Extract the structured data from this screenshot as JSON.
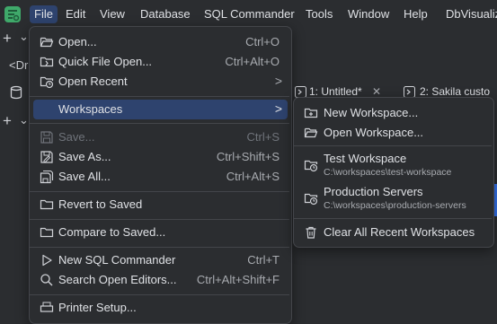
{
  "menubar": {
    "items": [
      "File",
      "Edit",
      "View",
      "Database",
      "SQL Commander",
      "Tools",
      "Window",
      "Help",
      "DbVisualiz"
    ]
  },
  "left_toolbar": {
    "plus": "+",
    "chevron": "⌄",
    "prefix": "<Dr"
  },
  "editor_tabs": [
    {
      "label": "1: Untitled*",
      "close": "✕"
    },
    {
      "label": "2: Sakila custo"
    }
  ],
  "file_menu": {
    "open": {
      "label": "Open...",
      "shortcut": "Ctrl+O"
    },
    "quick_open": {
      "label": "Quick File Open...",
      "shortcut": "Ctrl+Alt+O"
    },
    "open_recent": {
      "label": "Open Recent",
      "arrow": ">"
    },
    "workspaces": {
      "label": "Workspaces",
      "arrow": ">"
    },
    "save": {
      "label": "Save...",
      "shortcut": "Ctrl+S"
    },
    "save_as": {
      "label": "Save As...",
      "shortcut": "Ctrl+Shift+S"
    },
    "save_all": {
      "label": "Save All...",
      "shortcut": "Ctrl+Alt+S"
    },
    "revert": {
      "label": "Revert to Saved"
    },
    "compare": {
      "label": "Compare to Saved..."
    },
    "new_sql": {
      "label": "New SQL Commander",
      "shortcut": "Ctrl+T"
    },
    "search_editors": {
      "label": "Search Open Editors...",
      "shortcut": "Ctrl+Alt+Shift+F"
    },
    "printer_setup": {
      "label": "Printer Setup..."
    }
  },
  "workspaces_menu": {
    "new_workspace": "New Workspace...",
    "open_workspace": "Open Workspace...",
    "recent": [
      {
        "name": "Test Workspace",
        "path": "C:\\workspaces\\test-workspace"
      },
      {
        "name": "Production Servers",
        "path": "C:\\workspaces\\production-servers"
      }
    ],
    "clear_recent": "Clear All Recent Workspaces"
  },
  "colors": {
    "background": "#2b2d30",
    "highlight": "#2e436e",
    "logo": "#3fa96a",
    "text": "#dfe1e5",
    "muted": "#a8abb0"
  }
}
